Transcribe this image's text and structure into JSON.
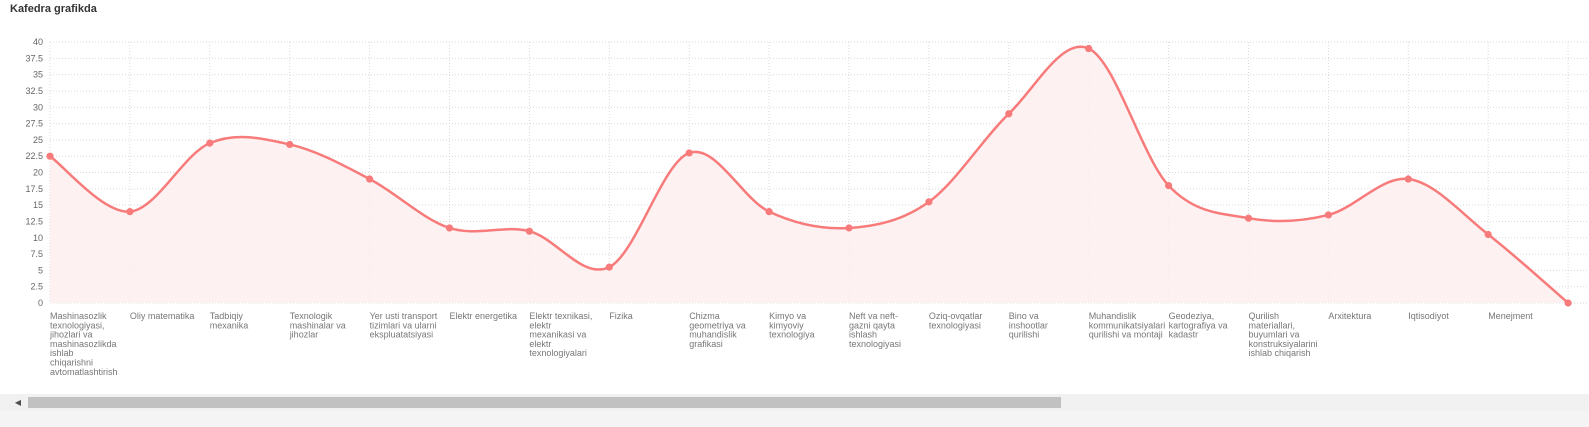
{
  "title": "Kafedra grafikda",
  "colors": {
    "line": "#f87b7b",
    "fill": "#fdeeee",
    "grid": "#d9d9d9",
    "tick_text": "#666666",
    "label_text": "#777777"
  },
  "chart_data": {
    "type": "line",
    "title": "",
    "xlabel": "",
    "ylabel": "",
    "ylim": [
      0,
      40
    ],
    "y_ticks": [
      0,
      2.5,
      5,
      7.5,
      10,
      12.5,
      15,
      17.5,
      20,
      22.5,
      25,
      27.5,
      30,
      32.5,
      35,
      37.5,
      40
    ],
    "y_tick_labels": [
      "0",
      "2.5",
      "5",
      "7.5",
      "10",
      "12.5",
      "15",
      "17.5",
      "20",
      "22.5",
      "25",
      "27.5",
      "30",
      "32.5",
      "35",
      "37.5",
      "40"
    ],
    "grid": true,
    "smooth": true,
    "filled": true,
    "categories": [
      "Mashinasozlik texnologiyasi, jihozlari va mashinasozlikda ishlab chiqarishni avtomatlashtirish",
      "Oliy matematika",
      "Tadbiqiy mexanika",
      "Texnologik mashinalar va jihozlar",
      "Yer usti transport tizimlari va ularni ekspluatatsiyasi",
      "Elektr energetika",
      "Elektr texnikasi, elektr mexanikasi va elektr texnologiyalari",
      "Fizika",
      "Chizma geometriya va muhandislik grafikasi",
      "Kimyo va kimyoviy texnologiya",
      "Neft va neft-gazni qayta ishlash texnologiyasi",
      "Oziq-ovqatlar texnologiyasi",
      "Bino va inshootlar qurilishi",
      "Muhandislik kommunikatsiyalari qurilishi va montaji",
      "Geodeziya, kartografiya va kadastr",
      "Qurilish materiallari, buyumlari va konstruksiyalarini ishlab chiqarish",
      "Arxitektura",
      "Iqtisodiyot",
      "Menejment",
      ""
    ],
    "category_label_lines": [
      [
        "Mashinasozlik",
        "texnologiyasi,",
        "jihozlari va",
        "mashinasozlikda",
        "ishlab",
        "chiqarishni",
        "avtomatlashtirish"
      ],
      [
        "Oliy matematika"
      ],
      [
        "Tadbiqiy",
        "mexanika"
      ],
      [
        "Texnologik",
        "mashinalar va",
        "jihozlar"
      ],
      [
        "Yer usti transport",
        "tizimlari va ularni",
        "ekspluatatsiyasi"
      ],
      [
        "Elektr energetika"
      ],
      [
        "Elektr texnikasi,",
        "elektr",
        "mexanikasi va",
        "elektr",
        "texnologiyalari"
      ],
      [
        "Fizika"
      ],
      [
        "Chizma",
        "geometriya va",
        "muhandislik",
        "grafikasi"
      ],
      [
        "Kimyo va",
        "kimyoviy",
        "texnologiya"
      ],
      [
        "Neft va neft-",
        "gazni qayta",
        "ishlash",
        "texnologiyasi"
      ],
      [
        "Oziq-ovqatlar",
        "texnologiyasi"
      ],
      [
        "Bino va",
        "inshootlar",
        "qurilishi"
      ],
      [
        "Muhandislik",
        "kommunikatsiyalari",
        "qurilishi va montaji"
      ],
      [
        "Geodeziya,",
        "kartografiya va",
        "kadastr"
      ],
      [
        "Qurilish",
        "materiallari,",
        "buyumlari va",
        "konstruksiyalarini",
        "ishlab chiqarish"
      ],
      [
        "Arxitektura"
      ],
      [
        "Iqtisodiyot"
      ],
      [
        "Menejment"
      ],
      []
    ],
    "values": [
      22.5,
      14,
      24.5,
      24.3,
      19,
      11.5,
      11,
      5.5,
      23,
      14,
      11.5,
      15.5,
      29,
      39,
      18,
      13,
      13.5,
      19,
      10.5,
      0
    ]
  }
}
